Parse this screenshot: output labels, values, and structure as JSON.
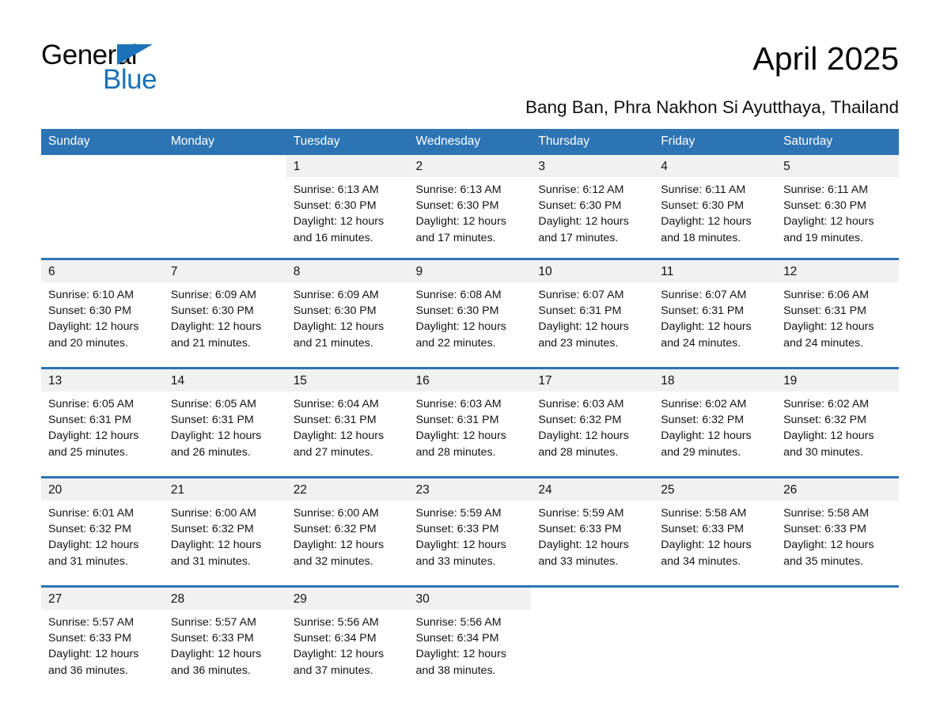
{
  "brand": {
    "name_part1": "General",
    "name_part2": "Blue",
    "logo_icon": "triangle-logo-icon"
  },
  "header": {
    "month_title": "April 2025",
    "location": "Bang Ban, Phra Nakhon Si Ayutthaya, Thailand"
  },
  "colors": {
    "header_blue": "#2d74b5",
    "brand_blue": "#1a72b8",
    "daynum_background": "#f1f1f1",
    "row_divider": "#2d74b5"
  },
  "weekday_headers": [
    "Sunday",
    "Monday",
    "Tuesday",
    "Wednesday",
    "Thursday",
    "Friday",
    "Saturday"
  ],
  "weeks": [
    [
      {
        "day": "",
        "blank": true
      },
      {
        "day": "",
        "blank": true
      },
      {
        "day": "1",
        "sunrise": "Sunrise: 6:13 AM",
        "sunset": "Sunset: 6:30 PM",
        "daylight_line1": "Daylight: 12 hours",
        "daylight_line2": "and 16 minutes."
      },
      {
        "day": "2",
        "sunrise": "Sunrise: 6:13 AM",
        "sunset": "Sunset: 6:30 PM",
        "daylight_line1": "Daylight: 12 hours",
        "daylight_line2": "and 17 minutes."
      },
      {
        "day": "3",
        "sunrise": "Sunrise: 6:12 AM",
        "sunset": "Sunset: 6:30 PM",
        "daylight_line1": "Daylight: 12 hours",
        "daylight_line2": "and 17 minutes."
      },
      {
        "day": "4",
        "sunrise": "Sunrise: 6:11 AM",
        "sunset": "Sunset: 6:30 PM",
        "daylight_line1": "Daylight: 12 hours",
        "daylight_line2": "and 18 minutes."
      },
      {
        "day": "5",
        "sunrise": "Sunrise: 6:11 AM",
        "sunset": "Sunset: 6:30 PM",
        "daylight_line1": "Daylight: 12 hours",
        "daylight_line2": "and 19 minutes."
      }
    ],
    [
      {
        "day": "6",
        "sunrise": "Sunrise: 6:10 AM",
        "sunset": "Sunset: 6:30 PM",
        "daylight_line1": "Daylight: 12 hours",
        "daylight_line2": "and 20 minutes."
      },
      {
        "day": "7",
        "sunrise": "Sunrise: 6:09 AM",
        "sunset": "Sunset: 6:30 PM",
        "daylight_line1": "Daylight: 12 hours",
        "daylight_line2": "and 21 minutes."
      },
      {
        "day": "8",
        "sunrise": "Sunrise: 6:09 AM",
        "sunset": "Sunset: 6:30 PM",
        "daylight_line1": "Daylight: 12 hours",
        "daylight_line2": "and 21 minutes."
      },
      {
        "day": "9",
        "sunrise": "Sunrise: 6:08 AM",
        "sunset": "Sunset: 6:30 PM",
        "daylight_line1": "Daylight: 12 hours",
        "daylight_line2": "and 22 minutes."
      },
      {
        "day": "10",
        "sunrise": "Sunrise: 6:07 AM",
        "sunset": "Sunset: 6:31 PM",
        "daylight_line1": "Daylight: 12 hours",
        "daylight_line2": "and 23 minutes."
      },
      {
        "day": "11",
        "sunrise": "Sunrise: 6:07 AM",
        "sunset": "Sunset: 6:31 PM",
        "daylight_line1": "Daylight: 12 hours",
        "daylight_line2": "and 24 minutes."
      },
      {
        "day": "12",
        "sunrise": "Sunrise: 6:06 AM",
        "sunset": "Sunset: 6:31 PM",
        "daylight_line1": "Daylight: 12 hours",
        "daylight_line2": "and 24 minutes."
      }
    ],
    [
      {
        "day": "13",
        "sunrise": "Sunrise: 6:05 AM",
        "sunset": "Sunset: 6:31 PM",
        "daylight_line1": "Daylight: 12 hours",
        "daylight_line2": "and 25 minutes."
      },
      {
        "day": "14",
        "sunrise": "Sunrise: 6:05 AM",
        "sunset": "Sunset: 6:31 PM",
        "daylight_line1": "Daylight: 12 hours",
        "daylight_line2": "and 26 minutes."
      },
      {
        "day": "15",
        "sunrise": "Sunrise: 6:04 AM",
        "sunset": "Sunset: 6:31 PM",
        "daylight_line1": "Daylight: 12 hours",
        "daylight_line2": "and 27 minutes."
      },
      {
        "day": "16",
        "sunrise": "Sunrise: 6:03 AM",
        "sunset": "Sunset: 6:31 PM",
        "daylight_line1": "Daylight: 12 hours",
        "daylight_line2": "and 28 minutes."
      },
      {
        "day": "17",
        "sunrise": "Sunrise: 6:03 AM",
        "sunset": "Sunset: 6:32 PM",
        "daylight_line1": "Daylight: 12 hours",
        "daylight_line2": "and 28 minutes."
      },
      {
        "day": "18",
        "sunrise": "Sunrise: 6:02 AM",
        "sunset": "Sunset: 6:32 PM",
        "daylight_line1": "Daylight: 12 hours",
        "daylight_line2": "and 29 minutes."
      },
      {
        "day": "19",
        "sunrise": "Sunrise: 6:02 AM",
        "sunset": "Sunset: 6:32 PM",
        "daylight_line1": "Daylight: 12 hours",
        "daylight_line2": "and 30 minutes."
      }
    ],
    [
      {
        "day": "20",
        "sunrise": "Sunrise: 6:01 AM",
        "sunset": "Sunset: 6:32 PM",
        "daylight_line1": "Daylight: 12 hours",
        "daylight_line2": "and 31 minutes."
      },
      {
        "day": "21",
        "sunrise": "Sunrise: 6:00 AM",
        "sunset": "Sunset: 6:32 PM",
        "daylight_line1": "Daylight: 12 hours",
        "daylight_line2": "and 31 minutes."
      },
      {
        "day": "22",
        "sunrise": "Sunrise: 6:00 AM",
        "sunset": "Sunset: 6:32 PM",
        "daylight_line1": "Daylight: 12 hours",
        "daylight_line2": "and 32 minutes."
      },
      {
        "day": "23",
        "sunrise": "Sunrise: 5:59 AM",
        "sunset": "Sunset: 6:33 PM",
        "daylight_line1": "Daylight: 12 hours",
        "daylight_line2": "and 33 minutes."
      },
      {
        "day": "24",
        "sunrise": "Sunrise: 5:59 AM",
        "sunset": "Sunset: 6:33 PM",
        "daylight_line1": "Daylight: 12 hours",
        "daylight_line2": "and 33 minutes."
      },
      {
        "day": "25",
        "sunrise": "Sunrise: 5:58 AM",
        "sunset": "Sunset: 6:33 PM",
        "daylight_line1": "Daylight: 12 hours",
        "daylight_line2": "and 34 minutes."
      },
      {
        "day": "26",
        "sunrise": "Sunrise: 5:58 AM",
        "sunset": "Sunset: 6:33 PM",
        "daylight_line1": "Daylight: 12 hours",
        "daylight_line2": "and 35 minutes."
      }
    ],
    [
      {
        "day": "27",
        "sunrise": "Sunrise: 5:57 AM",
        "sunset": "Sunset: 6:33 PM",
        "daylight_line1": "Daylight: 12 hours",
        "daylight_line2": "and 36 minutes."
      },
      {
        "day": "28",
        "sunrise": "Sunrise: 5:57 AM",
        "sunset": "Sunset: 6:33 PM",
        "daylight_line1": "Daylight: 12 hours",
        "daylight_line2": "and 36 minutes."
      },
      {
        "day": "29",
        "sunrise": "Sunrise: 5:56 AM",
        "sunset": "Sunset: 6:34 PM",
        "daylight_line1": "Daylight: 12 hours",
        "daylight_line2": "and 37 minutes."
      },
      {
        "day": "30",
        "sunrise": "Sunrise: 5:56 AM",
        "sunset": "Sunset: 6:34 PM",
        "daylight_line1": "Daylight: 12 hours",
        "daylight_line2": "and 38 minutes."
      },
      {
        "day": "",
        "blank": true
      },
      {
        "day": "",
        "blank": true
      },
      {
        "day": "",
        "blank": true
      }
    ]
  ]
}
